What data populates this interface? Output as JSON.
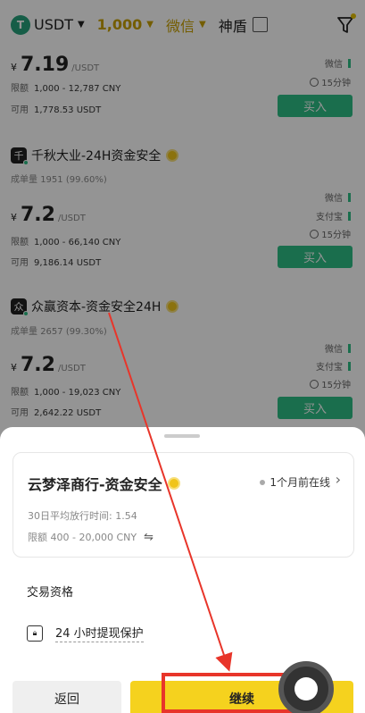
{
  "topbar": {
    "coin": "USDT",
    "amount": "1,000",
    "payment": "微信",
    "shield_label": "神盾"
  },
  "listings": [
    {
      "price_currency": "¥",
      "price": "7.19",
      "price_unit": "/USDT",
      "limit_label": "限额",
      "limit": "1,000 - 12,787 CNY",
      "available_label": "可用",
      "available": "1,778.53 USDT",
      "methods": [
        "微信"
      ],
      "time": "15分钟",
      "buy_label": "买入"
    },
    {
      "merchant": "千秋大业-24H资金安全",
      "avatar_char": "千",
      "orders_label": "成单量",
      "orders": "1951 (99.60%)",
      "price_currency": "¥",
      "price": "7.2",
      "price_unit": "/USDT",
      "limit_label": "限额",
      "limit": "1,000 - 66,140 CNY",
      "available_label": "可用",
      "available": "9,186.14 USDT",
      "methods": [
        "微信",
        "支付宝"
      ],
      "time": "15分钟",
      "buy_label": "买入"
    },
    {
      "merchant": "众赢资本-资金安全24H",
      "avatar_char": "众",
      "orders_label": "成单量",
      "orders": "2657 (99.30%)",
      "price_currency": "¥",
      "price": "7.2",
      "price_unit": "/USDT",
      "limit_label": "限额",
      "limit": "1,000 - 19,023 CNY",
      "available_label": "可用",
      "available": "2,642.22 USDT",
      "methods": [
        "微信",
        "支付宝"
      ],
      "time": "15分钟",
      "buy_label": "买入"
    }
  ],
  "sheet": {
    "merchant_name": "云梦泽商行-资金安全",
    "online_status": "1个月前在线",
    "avg_release": "30日平均放行时间: 1.54",
    "limit": "限额 400 - 20,000 CNY",
    "section_title": "交易资格",
    "protection": "24 小时提现保护",
    "back_label": "返回",
    "continue_label": "继续"
  },
  "colors": {
    "accent_yellow": "#f5d21e",
    "buy_green": "#2ebd85",
    "annotation_red": "#e8352a"
  }
}
